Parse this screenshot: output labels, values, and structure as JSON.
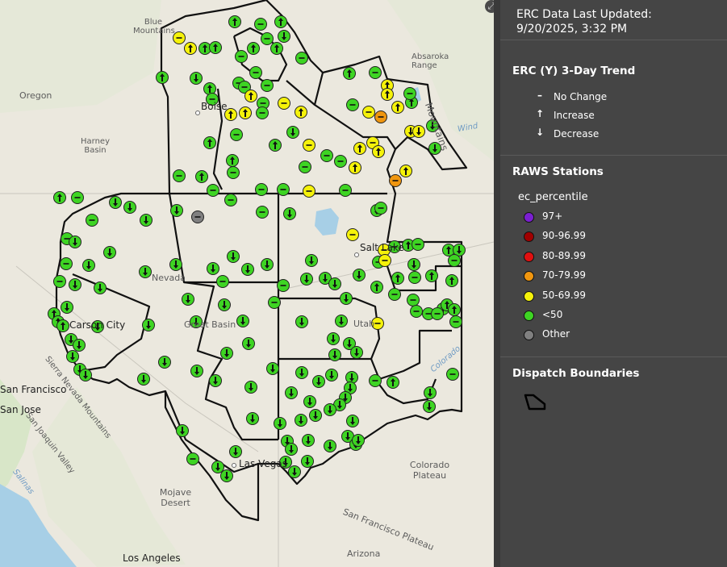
{
  "header": {
    "updated_label": "ERC Data Last Updated:",
    "updated_value": "9/20/2025, 3:32 PM"
  },
  "map": {
    "expand_icon": "expand-icon",
    "labels": {
      "oregon": "Oregon",
      "blue_mountains": "Blue Mountains",
      "harney_basin": "Harney Basin",
      "boise": "Boise",
      "absaroka_range": "Absaroka Range",
      "wind": "Wind",
      "mountains_partial": "Mountains",
      "nevada": "Nevada",
      "carson_city": "Carson City",
      "great_basin": "Great Basin",
      "sierra_nevada": "Sierra Nevada Mountains",
      "san_joaquin": "San Joaquin Valley",
      "san_francisco": "San Francisco",
      "san_jose": "San Jose",
      "salinas": "Salinas",
      "salt_lake": "Salt Lake",
      "utah": "Utah",
      "colorado_river": "Colorado",
      "colorado_plateau": "Colorado Plateau",
      "las_vegas": "Las Vegas",
      "mojave_desert": "Mojave Desert",
      "san_francisco_plateau": "San Francisco Plateau",
      "arizona": "Arizona",
      "los_angeles": "Los Angeles"
    },
    "stations_none": 250,
    "stations_increase": 24,
    "stations_decrease": 94,
    "stations_other": 1
  },
  "legend": {
    "trend_title": "ERC (Y) 3-Day Trend",
    "trend_items": [
      {
        "symbol": "–",
        "label": "No Change"
      },
      {
        "symbol": "↑",
        "label": "Increase"
      },
      {
        "symbol": "↓",
        "label": "Decrease"
      }
    ],
    "raws_title": "RAWS Stations",
    "field_name": "ec_percentile",
    "classes": [
      {
        "label": "97+",
        "color": "#7b1fd1"
      },
      {
        "label": "90-96.99",
        "color": "#a00000"
      },
      {
        "label": "80-89.99",
        "color": "#e01010"
      },
      {
        "label": "70-79.99",
        "color": "#f0960f"
      },
      {
        "label": "50-69.99",
        "color": "#f5f20a"
      },
      {
        "label": "<50",
        "color": "#3ed423"
      },
      {
        "label": "Other",
        "color": "#808080"
      }
    ],
    "dispatch_title": "Dispatch Boundaries"
  }
}
